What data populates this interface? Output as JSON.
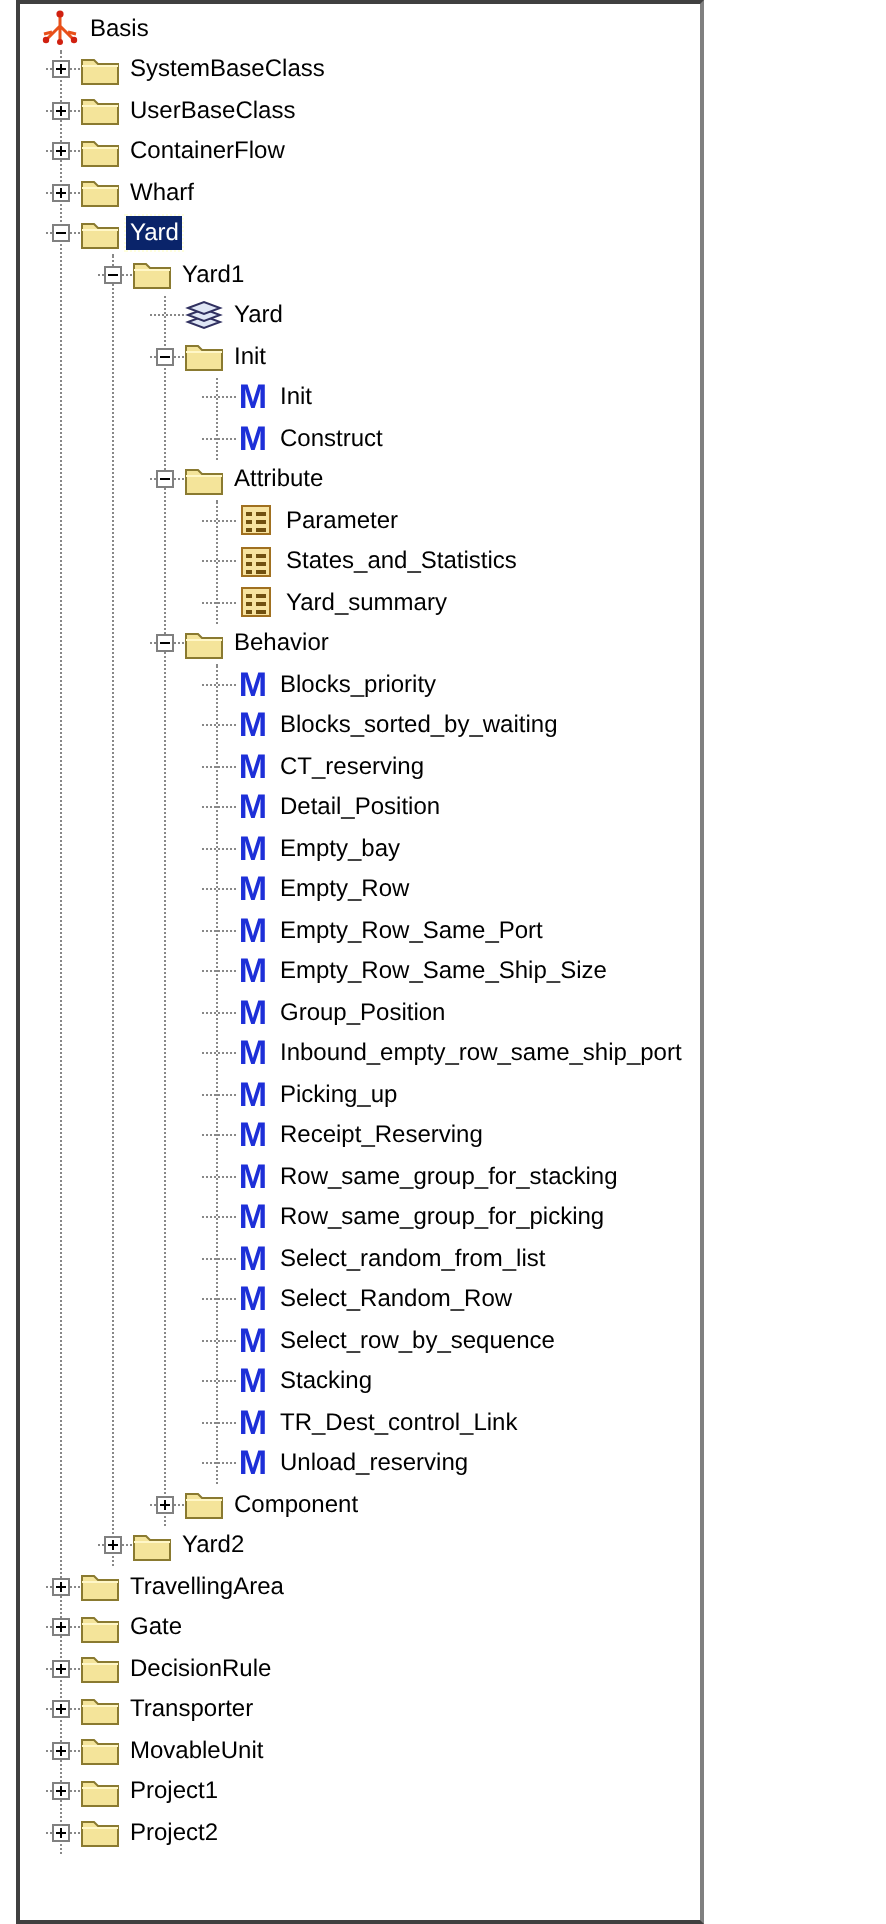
{
  "tree": {
    "label": "Basis",
    "kind": "root",
    "children": [
      {
        "label": "SystemBaseClass",
        "kind": "folder",
        "expanded": false,
        "selected": false
      },
      {
        "label": "UserBaseClass",
        "kind": "folder",
        "expanded": false,
        "selected": false
      },
      {
        "label": "ContainerFlow",
        "kind": "folder",
        "expanded": false,
        "selected": false
      },
      {
        "label": "Wharf",
        "kind": "folder",
        "expanded": false,
        "selected": false
      },
      {
        "label": "Yard",
        "kind": "folder",
        "expanded": true,
        "selected": true,
        "children": [
          {
            "label": "Yard1",
            "kind": "folder",
            "expanded": true,
            "selected": false,
            "children": [
              {
                "label": "Yard",
                "kind": "class",
                "selected": false
              },
              {
                "label": "Init",
                "kind": "folder",
                "expanded": true,
                "selected": false,
                "children": [
                  {
                    "label": "Init",
                    "kind": "method",
                    "mark": "M",
                    "selected": false
                  },
                  {
                    "label": "Construct",
                    "kind": "method",
                    "mark": "M",
                    "selected": false
                  }
                ]
              },
              {
                "label": "Attribute",
                "kind": "folder",
                "expanded": true,
                "selected": false,
                "children": [
                  {
                    "label": "Parameter",
                    "kind": "table",
                    "selected": false
                  },
                  {
                    "label": "States_and_Statistics",
                    "kind": "table",
                    "selected": false
                  },
                  {
                    "label": "Yard_summary",
                    "kind": "table",
                    "selected": false
                  }
                ]
              },
              {
                "label": "Behavior",
                "kind": "folder",
                "expanded": true,
                "selected": false,
                "children": [
                  {
                    "label": "Blocks_priority",
                    "kind": "method",
                    "mark": "M",
                    "selected": false
                  },
                  {
                    "label": "Blocks_sorted_by_waiting",
                    "kind": "method",
                    "mark": "M",
                    "selected": false
                  },
                  {
                    "label": "CT_reserving",
                    "kind": "method",
                    "mark": "M",
                    "selected": false
                  },
                  {
                    "label": "Detail_Position",
                    "kind": "method",
                    "mark": "M",
                    "selected": false
                  },
                  {
                    "label": "Empty_bay",
                    "kind": "method",
                    "mark": "M",
                    "selected": false
                  },
                  {
                    "label": "Empty_Row",
                    "kind": "method",
                    "mark": "M",
                    "selected": false
                  },
                  {
                    "label": "Empty_Row_Same_Port",
                    "kind": "method",
                    "mark": "M",
                    "selected": false
                  },
                  {
                    "label": "Empty_Row_Same_Ship_Size",
                    "kind": "method",
                    "mark": "M",
                    "selected": false
                  },
                  {
                    "label": "Group_Position",
                    "kind": "method",
                    "mark": "M",
                    "selected": false
                  },
                  {
                    "label": "Inbound_empty_row_same_ship_port",
                    "kind": "method",
                    "mark": "M",
                    "selected": false
                  },
                  {
                    "label": "Picking_up",
                    "kind": "method",
                    "mark": "M",
                    "selected": false
                  },
                  {
                    "label": "Receipt_Reserving",
                    "kind": "method",
                    "mark": "M",
                    "selected": false
                  },
                  {
                    "label": "Row_same_group_for_stacking",
                    "kind": "method",
                    "mark": "M",
                    "selected": false
                  },
                  {
                    "label": "Row_same_group_for_picking",
                    "kind": "method",
                    "mark": "M",
                    "selected": false
                  },
                  {
                    "label": "Select_random_from_list",
                    "kind": "method",
                    "mark": "M",
                    "selected": false
                  },
                  {
                    "label": "Select_Random_Row",
                    "kind": "method",
                    "mark": "M",
                    "selected": false
                  },
                  {
                    "label": "Select_row_by_sequence",
                    "kind": "method",
                    "mark": "M",
                    "selected": false
                  },
                  {
                    "label": "Stacking",
                    "kind": "method",
                    "mark": "M",
                    "selected": false
                  },
                  {
                    "label": "TR_Dest_control_Link",
                    "kind": "method",
                    "mark": "M",
                    "selected": false
                  },
                  {
                    "label": "Unload_reserving",
                    "kind": "method",
                    "mark": "M",
                    "selected": false
                  }
                ]
              },
              {
                "label": "Component",
                "kind": "folder",
                "expanded": false,
                "selected": false
              }
            ]
          },
          {
            "label": "Yard2",
            "kind": "folder",
            "expanded": false,
            "selected": false
          }
        ]
      },
      {
        "label": "TravellingArea",
        "kind": "folder",
        "expanded": false,
        "selected": false
      },
      {
        "label": "Gate",
        "kind": "folder",
        "expanded": false,
        "selected": false
      },
      {
        "label": "DecisionRule",
        "kind": "folder",
        "expanded": false,
        "selected": false
      },
      {
        "label": "Transporter",
        "kind": "folder",
        "expanded": false,
        "selected": false
      },
      {
        "label": "MovableUnit",
        "kind": "folder",
        "expanded": false,
        "selected": false
      },
      {
        "label": "Project1",
        "kind": "folder",
        "expanded": false,
        "selected": false
      },
      {
        "label": "Project2",
        "kind": "folder",
        "expanded": false,
        "selected": false
      }
    ]
  }
}
